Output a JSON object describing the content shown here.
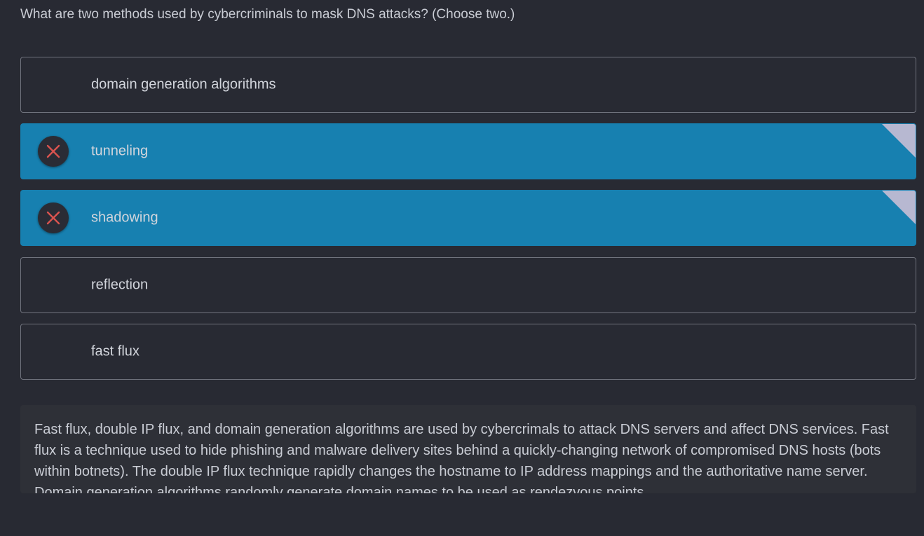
{
  "question": {
    "text": "What are two methods used by cybercriminals to mask DNS attacks? (Choose two.)"
  },
  "options": [
    {
      "label": "domain generation algorithms",
      "selected": false,
      "result_icon": ""
    },
    {
      "label": "tunneling",
      "selected": true,
      "result_icon": "close-icon"
    },
    {
      "label": "shadowing",
      "selected": true,
      "result_icon": "close-icon"
    },
    {
      "label": "reflection",
      "selected": false,
      "result_icon": ""
    },
    {
      "label": "fast flux",
      "selected": false,
      "result_icon": ""
    }
  ],
  "explanation": {
    "text": "Fast flux, double IP flux, and domain generation algorithms are used by cybercrimals to attack DNS servers and affect DNS services. Fast flux is a technique used to hide phishing and malware delivery sites behind a quickly-changing network of compromised DNS hosts (bots within botnets). The double IP flux technique rapidly changes the hostname to IP address mappings and the authoritative name server. Domain generation algorithms randomly generate domain names to be used as rendezvous points."
  },
  "colors": {
    "background": "#282a33",
    "selected_option": "#1780b0",
    "incorrect_mark": "#d9534f",
    "corner_flag": "#b7b8d1"
  }
}
